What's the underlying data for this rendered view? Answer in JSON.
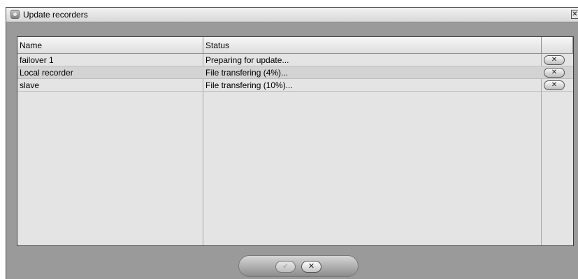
{
  "window": {
    "title": "Update recorders",
    "close_symbol": "✕",
    "icon": "recorder-update-icon"
  },
  "table": {
    "columns": [
      "Name",
      "Status",
      ""
    ],
    "rows": [
      {
        "name": "failover 1",
        "status": "Preparing for update..."
      },
      {
        "name": "Local recorder",
        "status": "File transfering (4%)..."
      },
      {
        "name": "slave",
        "status": "File transfering (10%)..."
      }
    ],
    "row_cancel_symbol": "✕"
  },
  "footer": {
    "ok_symbol": "✓",
    "ok_enabled": false,
    "cancel_symbol": "✕"
  },
  "colors": {
    "window_bg": "#9a9a9a",
    "table_bg": "#e4e4e4",
    "row_alt_bg": "#d3d3d3"
  }
}
